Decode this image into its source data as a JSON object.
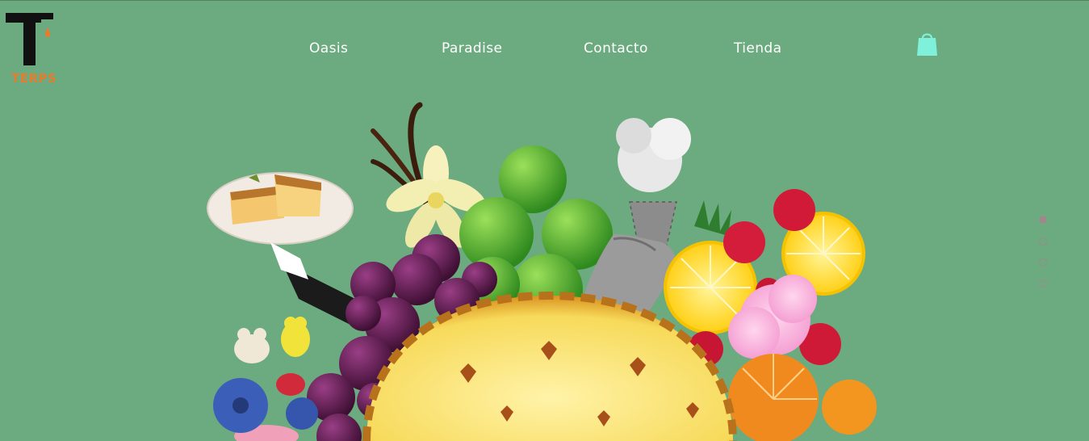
{
  "brand": {
    "name": "TERPS",
    "accent": "#e87a2c"
  },
  "nav": {
    "items": [
      {
        "label": "Oasis"
      },
      {
        "label": "Paradise"
      },
      {
        "label": "Contacto"
      },
      {
        "label": "Tienda"
      }
    ]
  },
  "cart": {
    "icon": "shopping-bag-icon",
    "color": "#7ff0d9"
  },
  "slider": {
    "count": 4,
    "active": 1
  },
  "colors": {
    "background": "#6cab80",
    "nav_text": "#ffffff",
    "dot": "#9c8a8a"
  }
}
